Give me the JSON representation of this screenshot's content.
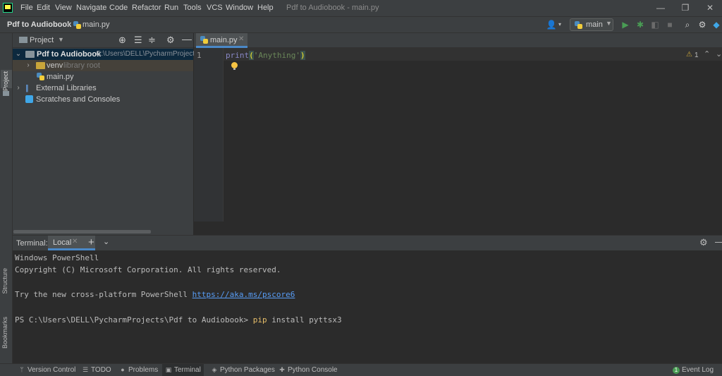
{
  "menubar": {
    "items": [
      {
        "label": "File"
      },
      {
        "label": "Edit"
      },
      {
        "label": "View"
      },
      {
        "label": "Navigate"
      },
      {
        "label": "Code"
      },
      {
        "label": "Refactor"
      },
      {
        "label": "Run"
      },
      {
        "label": "Tools"
      },
      {
        "label": "VCS"
      },
      {
        "label": "Window"
      },
      {
        "label": "Help"
      }
    ],
    "window_title": "Pdf to Audiobook - main.py",
    "minimize": "—",
    "restore": "❐",
    "close": "✕"
  },
  "navbar": {
    "project": "Pdf to Audiobook",
    "separator": "›",
    "file": "main.py",
    "run_config": "main"
  },
  "leftstrip": {
    "project_tab": "Project",
    "structure_tab": "Structure",
    "bookmarks_tab": "Bookmarks"
  },
  "project_panel": {
    "title": "Project",
    "root_name": "Pdf to Audiobook",
    "root_path": "C:\\Users\\DELL\\PycharmProjects\\",
    "venv_name": "venv",
    "venv_note": "library root",
    "file_name": "main.py",
    "external_libraries": "External Libraries",
    "scratches": "Scratches and Consoles"
  },
  "editor": {
    "tab_label": "main.py",
    "line_number": "1",
    "code_fn": "print",
    "code_open": "(",
    "code_str": "'Anything'",
    "code_close": ")",
    "warning_count": "1"
  },
  "terminal": {
    "label": "Terminal:",
    "tab_label": "Local",
    "lines": {
      "l1": "Windows PowerShell",
      "l2": "Copyright (C) Microsoft Corporation. All rights reserved.",
      "l3_prefix": "Try the new cross-platform PowerShell ",
      "l3_link": "https://aka.ms/pscore6",
      "prompt": "PS C:\\Users\\DELL\\PycharmProjects\\Pdf to Audiobook> ",
      "cmd": "pip",
      "args": " install pyttsx3"
    }
  },
  "bottombar": {
    "version_control": "Version Control",
    "todo": "TODO",
    "problems": "Problems",
    "terminal": "Terminal",
    "python_packages": "Python Packages",
    "python_console": "Python Console",
    "event_log": "Event Log",
    "event_log_count": "1"
  }
}
